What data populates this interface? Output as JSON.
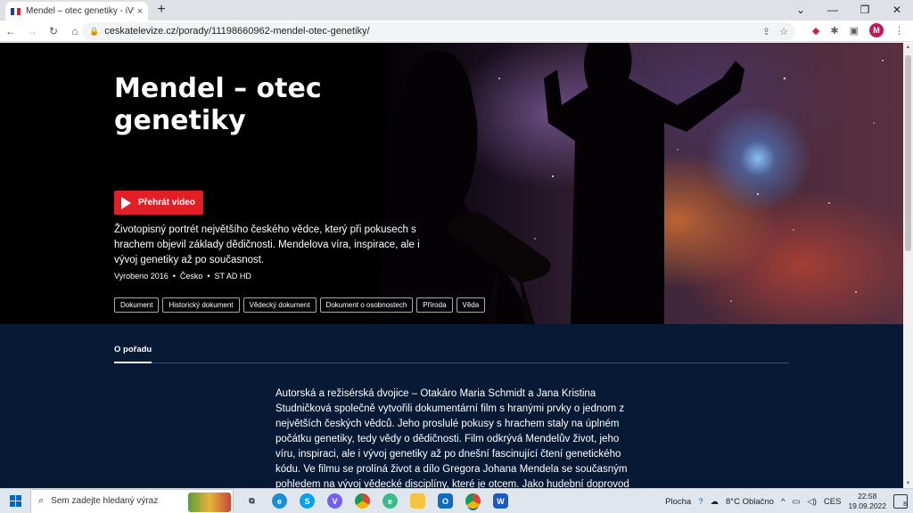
{
  "browser": {
    "tab_title": "Mendel – otec genetiky - iVysílá",
    "tab_close": "×",
    "new_tab": "+",
    "url": "ceskatelevize.cz/porady/11198660962-mendel-otec-genetiky/",
    "window_controls": [
      "⌄",
      "—",
      "❐",
      "✕"
    ],
    "avatar_letter": "M"
  },
  "hero": {
    "title": "Mendel – otec genetiky",
    "play_label": "Přehrát video",
    "description": "Životopisný portrét největšího českého vědce, který při pokusech s hrachem objevil základy dědičnosti. Mendelova víra, inspirace, ale i vývoj genetiky až po současnost.",
    "meta": [
      "Vyrobeno 2016",
      "•",
      "Česko",
      "•",
      "ST AD HD"
    ],
    "tags": [
      "Dokument",
      "Historický dokument",
      "Vědecký dokument",
      "Dokument o osobnostech",
      "Příroda",
      "Věda"
    ]
  },
  "section": {
    "tab_label": "O pořadu",
    "text": "Autorská a režisérská dvojice – Otakáro Maria Schmidt a Jana Kristina Studničková společně vytvořili dokumentární film s hranými prvky o jednom z největších českých vědců. Jeho proslulé pokusy s hrachem staly na úplném počátku genetiky, tedy vědy o dědičnosti. Film odkrývá Mendelův život, jeho víru, inspiraci, ale i vývoj genetiky až po dnešní fascinující čtení genetického kódu. Ve filmu se prolíná život a dílo Gregora Johana Mendela se současným pohledem na vývoj vědecké disciplíny, které je otcem. Jako hudební doprovod"
  },
  "taskbar": {
    "search_placeholder": "Sem zadejte hledaný výraz",
    "desktop_label": "Plocha",
    "weather": "8°C  Oblačno",
    "language": "CES",
    "time": "22:58",
    "date": "19.09.2022",
    "notifications": "8"
  },
  "colors": {
    "play_red": "#e21e26",
    "page_navy": "#061a36"
  }
}
